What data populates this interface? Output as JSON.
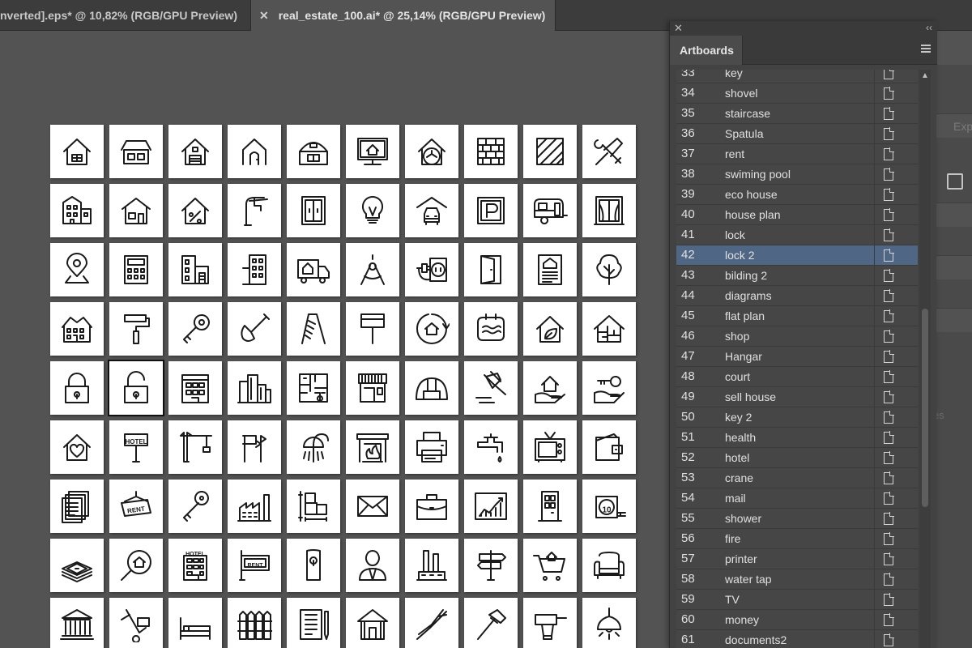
{
  "tabs": [
    {
      "label": "nverted].eps* @ 10,82% (RGB/GPU Preview)"
    },
    {
      "label": "real_estate_100.ai* @ 25,14% (RGB/GPU Preview)",
      "close": "✕"
    }
  ],
  "panel": {
    "close": "✕",
    "collapse": "‹‹",
    "title": "Artboards",
    "selected_index": 9,
    "rows": [
      {
        "num": "33",
        "name": "key"
      },
      {
        "num": "34",
        "name": "shovel"
      },
      {
        "num": "35",
        "name": "staircase"
      },
      {
        "num": "36",
        "name": "Spatula"
      },
      {
        "num": "37",
        "name": "rent"
      },
      {
        "num": "38",
        "name": "swiming pool"
      },
      {
        "num": "39",
        "name": "eco house"
      },
      {
        "num": "40",
        "name": "house plan"
      },
      {
        "num": "41",
        "name": "lock"
      },
      {
        "num": "42",
        "name": "lock 2"
      },
      {
        "num": "43",
        "name": "bilding 2"
      },
      {
        "num": "44",
        "name": "diagrams"
      },
      {
        "num": "45",
        "name": "flat plan"
      },
      {
        "num": "46",
        "name": "shop"
      },
      {
        "num": "47",
        "name": "Hangar"
      },
      {
        "num": "48",
        "name": "court"
      },
      {
        "num": "49",
        "name": "sell house"
      },
      {
        "num": "50",
        "name": "key 2"
      },
      {
        "num": "51",
        "name": "health"
      },
      {
        "num": "52",
        "name": "hotel"
      },
      {
        "num": "53",
        "name": "crane"
      },
      {
        "num": "54",
        "name": "mail"
      },
      {
        "num": "55",
        "name": "shower"
      },
      {
        "num": "56",
        "name": "fire"
      },
      {
        "num": "57",
        "name": "printer"
      },
      {
        "num": "58",
        "name": "water tap"
      },
      {
        "num": "59",
        "name": "TV"
      },
      {
        "num": "60",
        "name": "money"
      },
      {
        "num": "61",
        "name": "documents2"
      }
    ]
  },
  "side": {
    "exp_label": "Exp",
    "es_label": "es"
  },
  "canvas": {
    "active_artboard": 41,
    "icons": [
      "house",
      "house-wide",
      "garage",
      "house-door",
      "barn",
      "monitor-house",
      "house-fan",
      "brick-wall",
      "tiles",
      "tools",
      "apartment",
      "house-small",
      "percent-house",
      "faucet",
      "elevator",
      "bulb",
      "car-garage",
      "parking",
      "caravan",
      "window",
      "map-pin",
      "calculator",
      "buildings",
      "tower",
      "truck-house",
      "compass",
      "socket",
      "door",
      "document",
      "tree",
      "big-house",
      "paint-roller",
      "key",
      "shovel",
      "ladder",
      "spatula",
      "house-cycle",
      "pool",
      "eco-house",
      "house-plan",
      "lock",
      "lock-open",
      "office-building",
      "skyline",
      "floor-plan",
      "shop",
      "hangar",
      "gavel",
      "hand-house",
      "hand-key",
      "heart-house",
      "hotel-sign",
      "crane",
      "signpost",
      "shower",
      "fireplace",
      "printer",
      "water-tap",
      "tv",
      "wallet",
      "documents",
      "rent-sign",
      "key-old",
      "factory",
      "plan",
      "mail",
      "briefcase",
      "chart",
      "door-panel",
      "tape-measure",
      "money",
      "search-house",
      "hotel-building",
      "rent-board",
      "door-hanger",
      "person",
      "factory-2",
      "direction",
      "cart",
      "armchair",
      "bank",
      "hand-truck",
      "bed",
      "fence",
      "document-2",
      "hut",
      "shears",
      "hammer",
      "drill",
      "lamp"
    ],
    "labels": {
      "hotel": "HOTEL",
      "rent": "RENT",
      "parking": "P",
      "tape": "10",
      "percent": "%"
    }
  }
}
